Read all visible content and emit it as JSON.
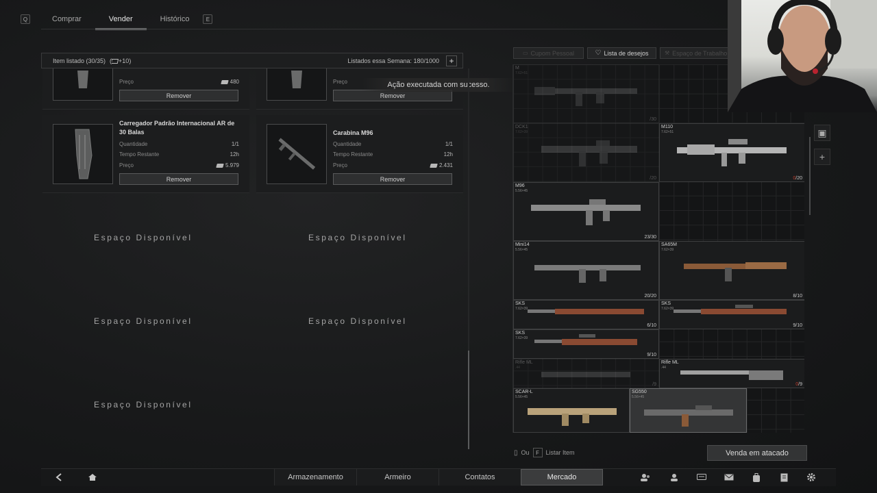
{
  "nav": {
    "left_key": "Q",
    "right_key": "E",
    "tabs": [
      {
        "label": "Comprar"
      },
      {
        "label": "Vender"
      },
      {
        "label": "Histórico"
      }
    ]
  },
  "listing": {
    "items_listed": "Item listado (30/35)",
    "bonus": "+10",
    "week_listed": "Listados essa Semana: 180/1000",
    "add_label": "+"
  },
  "toast": "Ação executada com sucesso.",
  "cards": [
    {
      "price_label": "Preço",
      "price": "480",
      "remove": "Remover"
    },
    {
      "price_label": "Preço",
      "price": "",
      "remove": "Remover"
    },
    {
      "title": "Carregador Padrão Internacional AR de 30 Balas",
      "qty_label": "Quantidade",
      "qty": "1/1",
      "time_label": "Tempo Restante",
      "time": "12h",
      "price_label": "Preço",
      "price": "5.979",
      "remove": "Remover"
    },
    {
      "title": "Carabina M96",
      "qty_label": "Quantidade",
      "qty": "1/1",
      "time_label": "Tempo Restante",
      "time": "12h",
      "price_label": "Preço",
      "price": "2.431",
      "remove": "Remover"
    }
  ],
  "empty_slot": "Espaço Disponível",
  "right_tabs": [
    {
      "label": "Cupom Pessoal"
    },
    {
      "label": "Lista de desejos"
    },
    {
      "label": "Espaço de Trabalho"
    }
  ],
  "inventory": [
    {
      "name": "M",
      "caliber": "7.62×51",
      "count": "/30",
      "zero": ""
    },
    {
      "name": "DCK1",
      "caliber": "7.62×39",
      "count": "/20",
      "zero": ""
    },
    {
      "name": "M110",
      "caliber": "7.62×51",
      "count": "/20",
      "zero": "0"
    },
    {
      "name": "M96",
      "caliber": "5.56×45",
      "count": "23/30",
      "zero": ""
    },
    {
      "name": "Mini14",
      "caliber": "5.56×45",
      "count": "20/20",
      "zero": ""
    },
    {
      "name": "SA65M",
      "caliber": "7.62×39",
      "count": "8/10",
      "zero": ""
    },
    {
      "name": "SKS",
      "caliber": "7.62×39",
      "count": "6/10",
      "zero": ""
    },
    {
      "name": "SKS",
      "caliber": "7.62×39",
      "count": "9/10",
      "zero": ""
    },
    {
      "name": "SKS",
      "caliber": "7.62×39",
      "count": "9/10",
      "zero": ""
    },
    {
      "name": "Rifle ML",
      "caliber": ".44",
      "count": "/9",
      "zero": ""
    },
    {
      "name": "Rifle ML",
      "caliber": ".44",
      "count": "/9",
      "zero": "0"
    },
    {
      "name": "SCAR-L",
      "caliber": "5.56×45",
      "count": "",
      "zero": ""
    },
    {
      "name": "SG550",
      "caliber": "5.56×45",
      "count": "",
      "zero": ""
    }
  ],
  "hint": {
    "or": "Ou",
    "key": "F",
    "action": "Listar Item"
  },
  "bulk_sell": "Venda em atacado",
  "bottom_tabs": [
    {
      "label": "Armazenamento"
    },
    {
      "label": "Armeiro"
    },
    {
      "label": "Contatos"
    },
    {
      "label": "Mercado"
    }
  ],
  "bottom_icons": [
    "back-icon",
    "home-icon",
    "squad-icon",
    "profile-icon",
    "chat-icon",
    "mail-icon",
    "backpack-icon",
    "tasks-icon",
    "settings-icon"
  ]
}
